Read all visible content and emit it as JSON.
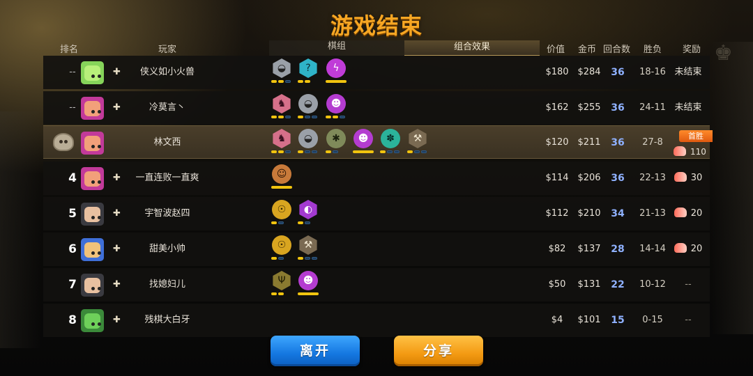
{
  "title": "游戏结束",
  "header": {
    "rank": "排名",
    "player": "玩家",
    "group": "棋组",
    "combo": "组合效果",
    "value": "价值",
    "gold": "金币",
    "rounds": "回合数",
    "wl": "胜负",
    "reward": "奖励"
  },
  "rows": [
    {
      "rank": "--",
      "name": "侠义如小火兽",
      "value": "$180",
      "gold": "$284",
      "rounds": "36",
      "wl": "18-16",
      "reward": "未结束"
    },
    {
      "rank": "--",
      "name": "冷莫言丶",
      "value": "$162",
      "gold": "$255",
      "rounds": "36",
      "wl": "24-11",
      "reward": "未结束"
    },
    {
      "rank": "",
      "name": "林文西",
      "value": "$120",
      "gold": "$211",
      "rounds": "36",
      "wl": "27-8",
      "badge": "首胜",
      "reward": "110"
    },
    {
      "rank": "4",
      "name": "一直连败一直爽",
      "value": "$114",
      "gold": "$206",
      "rounds": "36",
      "wl": "22-13",
      "reward": "30"
    },
    {
      "rank": "5",
      "name": "宇智波赵四",
      "value": "$112",
      "gold": "$210",
      "rounds": "34",
      "wl": "21-13",
      "reward": "20"
    },
    {
      "rank": "6",
      "name": "甜美小帅",
      "value": "$82",
      "gold": "$137",
      "rounds": "28",
      "wl": "14-14",
      "reward": "20"
    },
    {
      "rank": "7",
      "name": "找媳妇儿",
      "value": "$50",
      "gold": "$131",
      "rounds": "22",
      "wl": "10-12",
      "reward": "--"
    },
    {
      "rank": "8",
      "name": "残棋大白牙",
      "value": "$4",
      "gold": "$101",
      "rounds": "15",
      "wl": "0-15",
      "reward": "--"
    }
  ],
  "buttons": {
    "leave": "离开",
    "share": "分享"
  },
  "colors": {
    "title": "#f6a623",
    "rounds": "#8fb1ff",
    "pip_on": "#f1c40f",
    "pip_off": "#1e3a5a",
    "leave": "#1477e0",
    "share": "#f39a12"
  }
}
